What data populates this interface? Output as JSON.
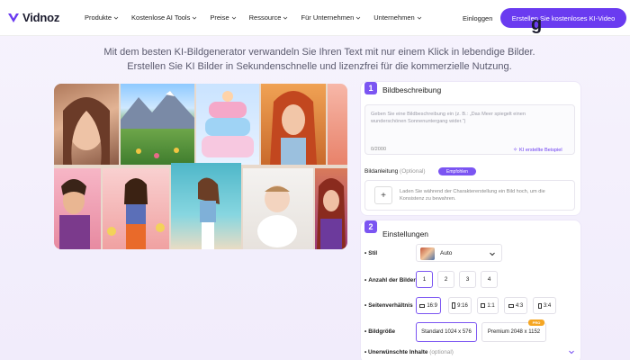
{
  "brand": {
    "name": "Vidnoz",
    "accent": "#6a3bf0"
  },
  "nav": {
    "items": [
      {
        "label": "Produkte"
      },
      {
        "label": "Kostenlose AI Tools"
      },
      {
        "label": "Preise"
      },
      {
        "label": "Ressource"
      },
      {
        "label": "Für Unternehmen"
      },
      {
        "label": "Unternehmen"
      }
    ],
    "login": "Einloggen",
    "cta": "Erstellen Sie kostenloses KI-Video"
  },
  "hero": {
    "title_fragment": "g",
    "subtitle": "Mit dem besten KI-Bildgenerator verwandeln Sie Ihren Text mit nur einem Klick in lebendige Bilder. Erstellen Sie KI Bilder in Sekundenschnelle und lizenzfrei für die kommerzielle Nutzung."
  },
  "step1": {
    "number": "1",
    "title": "Bildbeschreibung",
    "placeholder": "Geben Sie eine Bildbeschreibung ein (z. B.: „Das Meer spiegelt einen wunderschönen Sonnenuntergang wider.“)",
    "count": "0/2000",
    "example_link": "KI erstellte Beispiel",
    "bildanleitung_label": "Bildanleitung",
    "bildanleitung_optional": "(Optional)",
    "badge": "Empfohlen",
    "upload_text": "Laden Sie während der Charaktererstellung ein Bild hoch, um die Konsistenz zu bewahren.",
    "plus": "+"
  },
  "step2": {
    "number": "2",
    "title": "Einstellungen",
    "stil_label": "Stil",
    "stil_value": "Auto",
    "anzahl_label": "Anzahl der Bilder",
    "anzahl_options": [
      "1",
      "2",
      "3",
      "4"
    ],
    "seiten_label": "Seitenverhältnis",
    "seiten_options": [
      "16:9",
      "9:16",
      "1:1",
      "4:3",
      "3:4"
    ],
    "groesse_label": "Bildgröße",
    "groesse_options": [
      "Standard  1024 x 576",
      "Premium  2048 x 1152"
    ],
    "pro_badge": "PRO",
    "unerw_label": "Unerwünschte Inhalte",
    "unerw_optional": "(optional)"
  }
}
